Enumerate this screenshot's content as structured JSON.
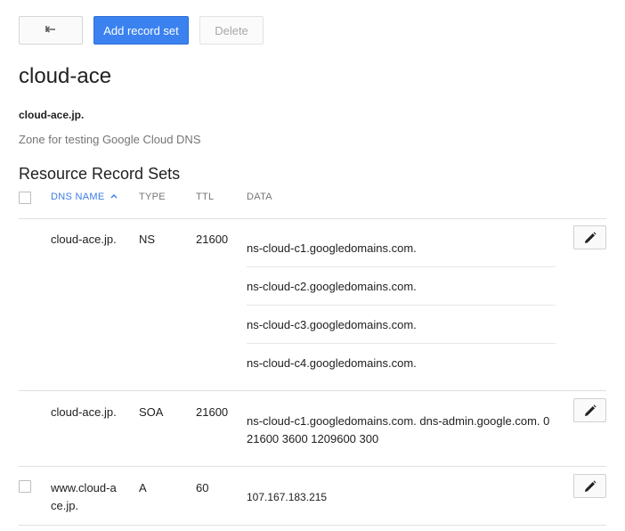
{
  "toolbar": {
    "back_icon": "back-arrow-icon",
    "add_label": "Add record set",
    "delete_label": "Delete",
    "accent_color": "#3b82f0"
  },
  "zone": {
    "title": "cloud-ace",
    "dns_name": "cloud-ace.jp.",
    "description": "Zone for testing Google Cloud DNS"
  },
  "records_section": {
    "heading": "Resource Record Sets",
    "columns": {
      "dns_name": "DNS NAME",
      "sort_icon": "sort-ascending-icon",
      "type": "TYPE",
      "ttl": "TTL",
      "data": "DATA"
    },
    "rows": [
      {
        "dns_name": "cloud-ace.jp.",
        "type": "NS",
        "ttl": "21600",
        "data": [
          "ns-cloud-c1.googledomains.com.",
          "ns-cloud-c2.googledomains.com.",
          "ns-cloud-c3.googledomains.com.",
          "ns-cloud-c4.googledomains.com."
        ],
        "selectable": false
      },
      {
        "dns_name": "cloud-ace.jp.",
        "type": "SOA",
        "ttl": "21600",
        "data": [
          "ns-cloud-c1.googledomains.com. dns-admin.google.com. 0",
          "21600 3600 1209600 300"
        ],
        "selectable": false
      },
      {
        "dns_name_lines": [
          "www.cloud-a",
          "ce.jp."
        ],
        "type": "A",
        "ttl": "60",
        "data": [
          "107.167.183.215"
        ],
        "selectable": true
      }
    ]
  }
}
